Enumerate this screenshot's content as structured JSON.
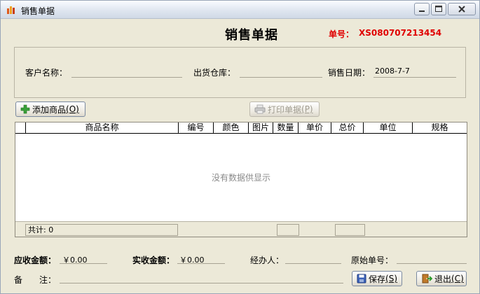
{
  "window": {
    "title": "销售单据"
  },
  "header": {
    "doc_title": "销售单据",
    "doc_no_label": "单号：",
    "doc_no_value": "XS080707213454"
  },
  "info": {
    "customer_label": "客户名称：",
    "customer_value": "",
    "warehouse_label": "出货仓库：",
    "warehouse_value": "",
    "date_label": "销售日期：",
    "date_value": "2008-7-7"
  },
  "toolbar": {
    "add_label": "添加商品",
    "add_key": "(O)",
    "print_label": "打印单据",
    "print_key": "(P)"
  },
  "grid": {
    "columns": [
      "商品名称",
      "编号",
      "颜色",
      "图片",
      "数量",
      "单价",
      "总价",
      "单位",
      "规格"
    ],
    "empty_text": "没有数据供显示",
    "total_label": "共计:",
    "total_value": "0"
  },
  "footer": {
    "receivable_label": "应收金额：",
    "receivable_value": "￥0.00",
    "received_label": "实收金额：",
    "received_value": "￥0.00",
    "handler_label": "经办人：",
    "handler_value": "",
    "orig_no_label": "原始单号：",
    "orig_no_value": "",
    "remark_label": "备　　注：",
    "remark_value": "",
    "save_label": "保存",
    "save_key": "(S)",
    "exit_label": "退出",
    "exit_key": "(C)"
  },
  "colors": {
    "doc_no": "#e00000",
    "window_bg": "#ece9d8"
  }
}
